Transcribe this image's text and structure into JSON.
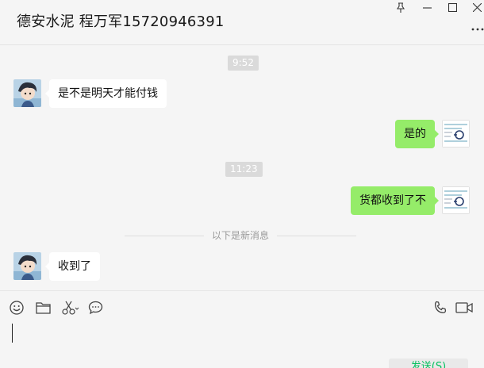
{
  "window": {
    "title": "德安水泥 程万军15720946391",
    "controls": [
      "pin-icon",
      "minimize-icon",
      "maximize-icon",
      "close-icon"
    ],
    "more_menu_icon": "more-icon"
  },
  "messages": {
    "time_1": "9:52",
    "msg_1": "是不是明天才能付钱",
    "msg_2": "是的",
    "time_2": "11:23",
    "msg_3": "货都收到了不",
    "new_divider": "以下是新消息",
    "msg_4": "收到了"
  },
  "toolbar": {
    "icons": [
      "emoji-icon",
      "folder-icon",
      "screenshot-scissors-icon",
      "chat-history-icon",
      "voice-call-icon",
      "video-call-icon"
    ]
  },
  "input": {
    "value": "",
    "send_label": "发送(S)"
  },
  "colors": {
    "outgoing_bubble": "#95ec69",
    "incoming_bubble": "#ffffff",
    "background": "#f5f5f5",
    "send_text": "#07c160"
  }
}
